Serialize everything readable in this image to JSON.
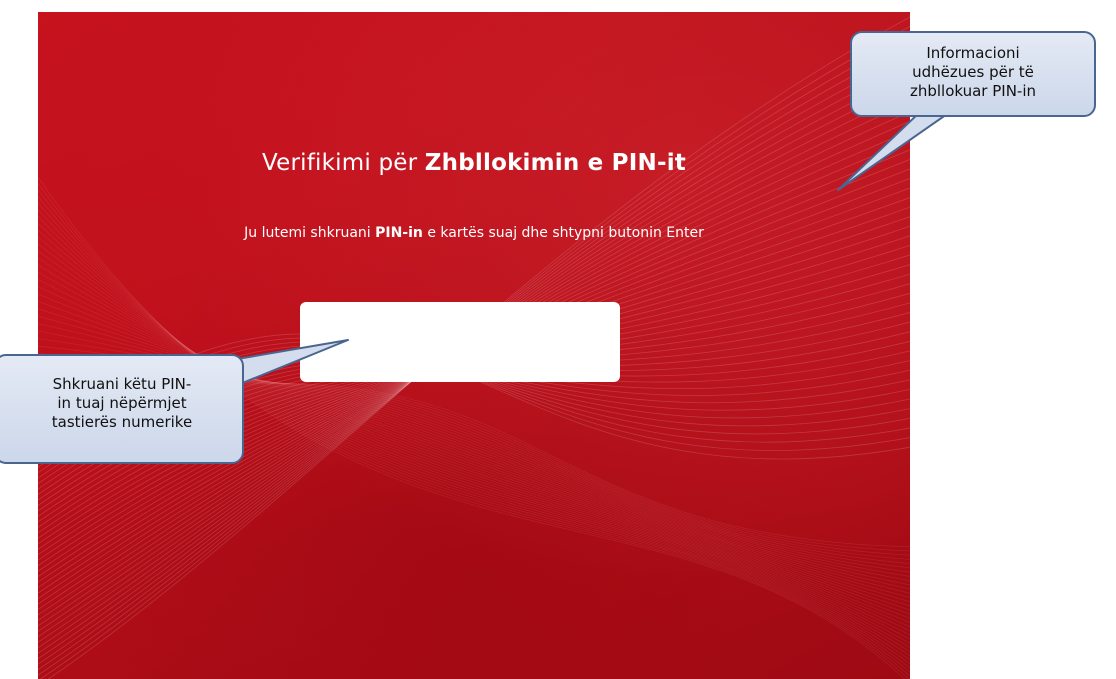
{
  "screen": {
    "title_regular": "Verifikimi për ",
    "title_bold": "Zhbllokimin e PIN-it",
    "instruction_before": "Ju lutemi shkruani ",
    "instruction_bold": "PIN-in",
    "instruction_after": " e kartës suaj dhe shtypni butonin Enter",
    "pin_value": "",
    "colors": {
      "background": "#b80f1a",
      "text": "#ffffff"
    }
  },
  "callouts": {
    "top_right": {
      "line1": "Informacioni",
      "line2": "udhëzues për të",
      "line3": "zhbllokuar PIN-in"
    },
    "left": {
      "line1": "Shkruani këtu PIN-",
      "line2": "in tuaj nëpërmjet",
      "line3": "tastierës numerike"
    },
    "colors": {
      "fill": "#d8e0ef",
      "border": "#4a6590"
    }
  }
}
